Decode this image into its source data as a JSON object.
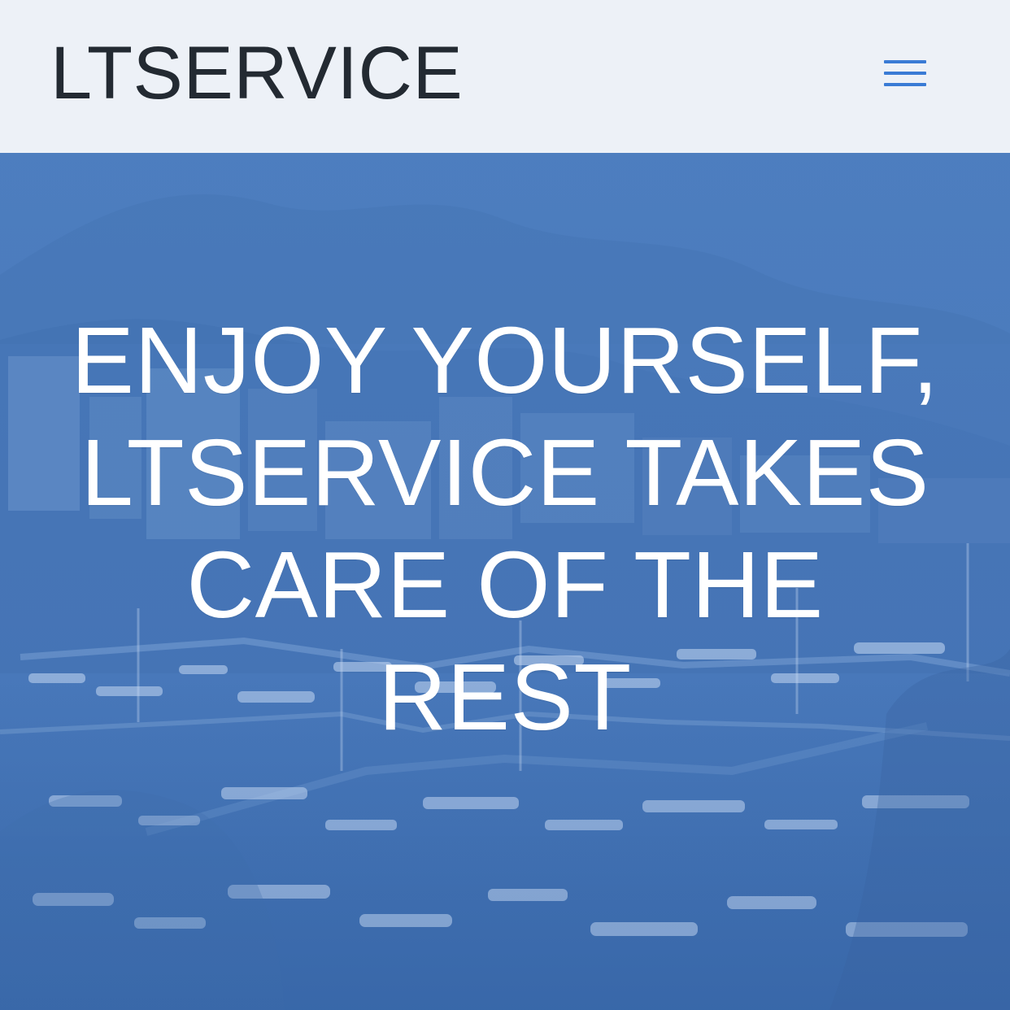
{
  "header": {
    "brand": "LTSERVICE"
  },
  "menu": {
    "icon": "hamburger-menu-icon"
  },
  "hero": {
    "title": "ENJOY YOURSELF, LTSERVICE TAKES CARE OF THE REST"
  },
  "theme": {
    "header_background": "#edf1f7",
    "brand_color": "#232a32",
    "menu_color": "#3a7bd5",
    "hero_blue": "#4a7cbf",
    "hero_text": "#ffffff"
  }
}
